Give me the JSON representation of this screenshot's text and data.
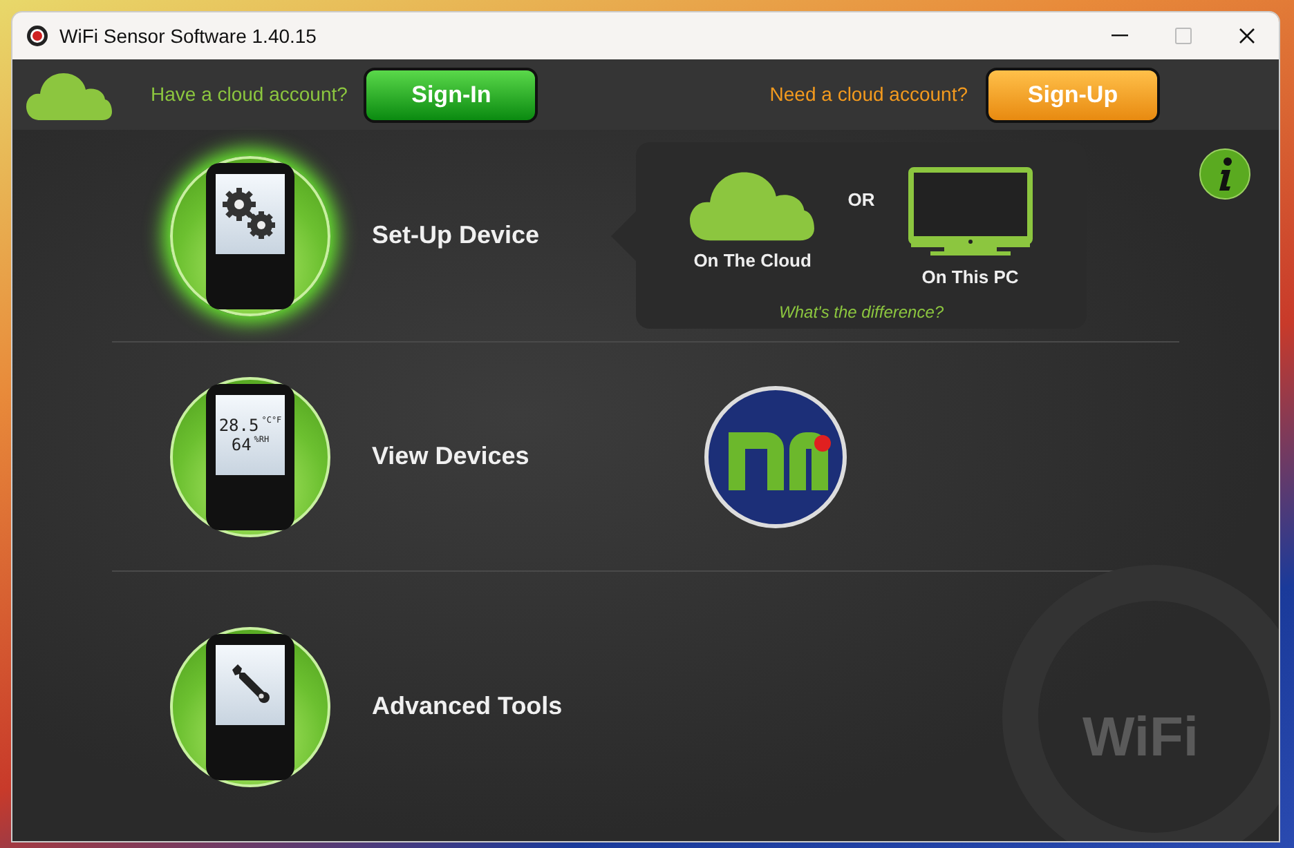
{
  "window": {
    "title": "WiFi Sensor Software 1.40.15"
  },
  "top_bar": {
    "sign_in_prompt": "Have a cloud account?",
    "sign_in_button": "Sign-In",
    "sign_up_prompt": "Need a cloud account?",
    "sign_up_button": "Sign-Up"
  },
  "menu": [
    {
      "kind": "setup",
      "label": "Set-Up Device",
      "selected": true
    },
    {
      "kind": "view",
      "label": "View Devices",
      "selected": false,
      "screen_lines": [
        {
          "value": "28.5",
          "unit": "°C°F"
        },
        {
          "value": "64",
          "unit": "%RH"
        }
      ]
    },
    {
      "kind": "tools",
      "label": "Advanced Tools",
      "selected": false
    }
  ],
  "setup_options": {
    "options": [
      {
        "kind": "cloud",
        "label": "On The Cloud"
      },
      {
        "kind": "pc",
        "label": "On This PC"
      }
    ],
    "separator": "OR",
    "help_link": "What's the difference?"
  },
  "watermark_text": "WiFi"
}
